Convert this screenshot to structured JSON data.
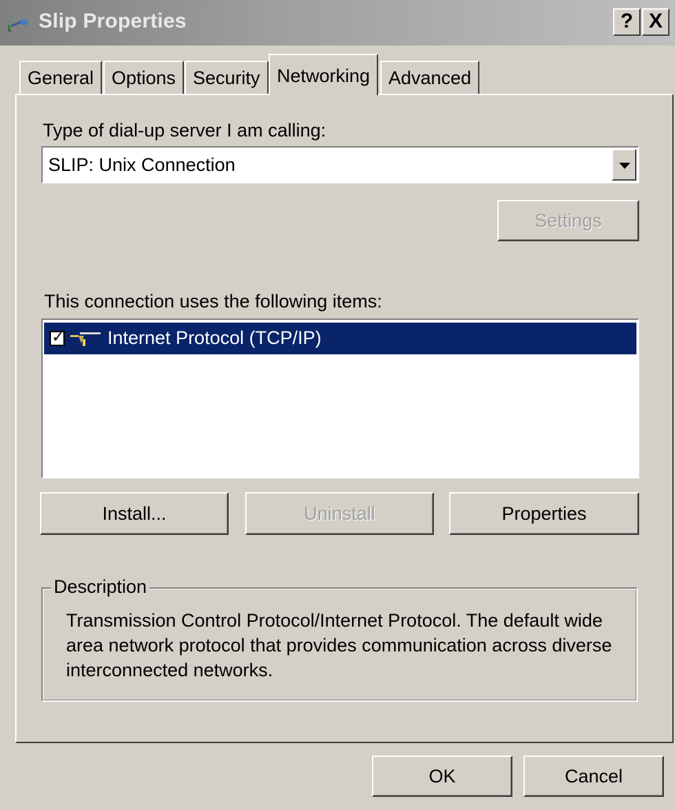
{
  "window": {
    "title": "Slip Properties",
    "icon": "network-connection-icon",
    "help_label": "?",
    "close_label": "X"
  },
  "tabs": [
    {
      "label": "General",
      "active": false
    },
    {
      "label": "Options",
      "active": false
    },
    {
      "label": "Security",
      "active": false
    },
    {
      "label": "Networking",
      "active": true
    },
    {
      "label": "Advanced",
      "active": false
    }
  ],
  "networking": {
    "server_type_label": "Type of dial-up server I am calling:",
    "server_type_value": "SLIP: Unix Connection",
    "settings_button": "Settings",
    "items_label": "This connection uses the following items:",
    "items": [
      {
        "label": "Internet Protocol (TCP/IP)",
        "checked": true,
        "selected": true,
        "icon": "network-protocol-icon"
      }
    ],
    "install_button": "Install...",
    "uninstall_button": "Uninstall",
    "properties_button": "Properties",
    "description_title": "Description",
    "description_text": "Transmission Control Protocol/Internet Protocol. The default wide area network protocol that provides communication across diverse interconnected networks."
  },
  "footer": {
    "ok_button": "OK",
    "cancel_button": "Cancel"
  },
  "colors": {
    "face": "#d4d0c8",
    "selection": "#0a246a",
    "disabled_text": "#a0a0a0"
  }
}
